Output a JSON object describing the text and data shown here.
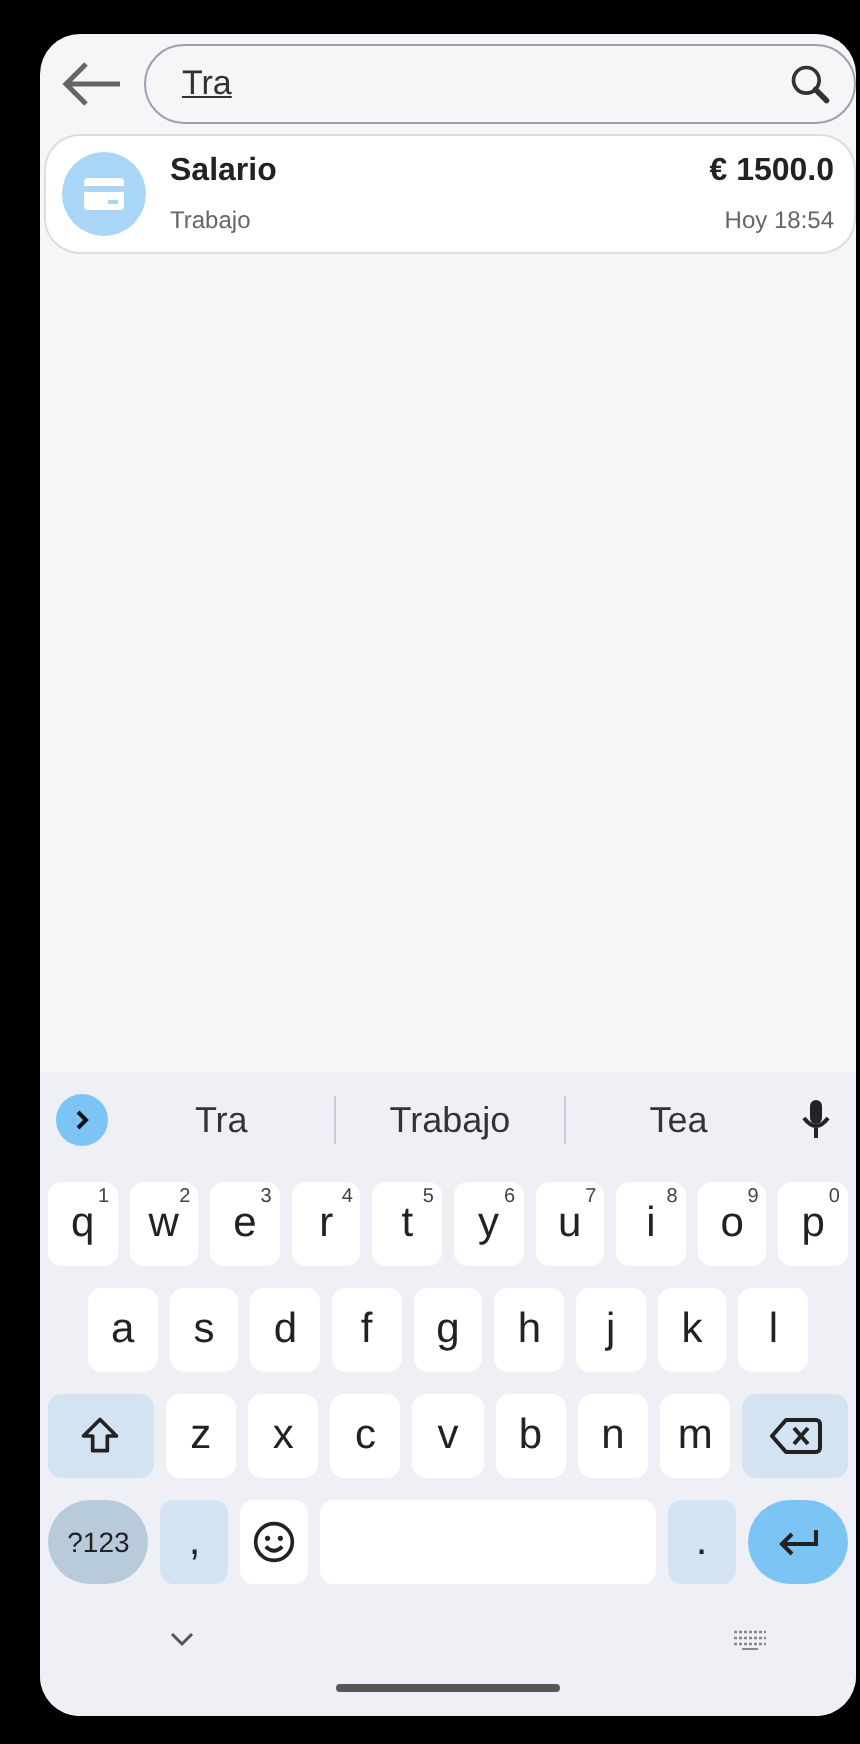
{
  "search": {
    "value": "Tra"
  },
  "results": [
    {
      "title": "Salario",
      "category": "Trabajo",
      "amount": "€ 1500.0",
      "time": "Hoy 18:54"
    }
  ],
  "keyboard": {
    "suggestions": [
      "Tra",
      "Trabajo",
      "Tea"
    ],
    "top_row": [
      {
        "kind": "letter",
        "label": "q",
        "hint": "1"
      },
      {
        "kind": "letter",
        "label": "w",
        "hint": "2"
      },
      {
        "kind": "letter",
        "label": "e",
        "hint": "3"
      },
      {
        "kind": "letter",
        "label": "r",
        "hint": "4"
      },
      {
        "kind": "letter",
        "label": "t",
        "hint": "5"
      },
      {
        "kind": "letter",
        "label": "y",
        "hint": "6"
      },
      {
        "kind": "letter",
        "label": "u",
        "hint": "7"
      },
      {
        "kind": "letter",
        "label": "i",
        "hint": "8"
      },
      {
        "kind": "letter",
        "label": "o",
        "hint": "9"
      },
      {
        "kind": "letter",
        "label": "p",
        "hint": "0"
      }
    ],
    "home_row": [
      {
        "kind": "letter",
        "label": "a"
      },
      {
        "kind": "letter",
        "label": "s"
      },
      {
        "kind": "letter",
        "label": "d"
      },
      {
        "kind": "letter",
        "label": "f"
      },
      {
        "kind": "letter",
        "label": "g"
      },
      {
        "kind": "letter",
        "label": "h"
      },
      {
        "kind": "letter",
        "label": "j"
      },
      {
        "kind": "letter",
        "label": "k"
      },
      {
        "kind": "letter",
        "label": "l"
      }
    ],
    "bottom_row": [
      {
        "kind": "shift"
      },
      {
        "kind": "letter",
        "label": "z"
      },
      {
        "kind": "letter",
        "label": "x"
      },
      {
        "kind": "letter",
        "label": "c"
      },
      {
        "kind": "letter",
        "label": "v"
      },
      {
        "kind": "letter",
        "label": "b"
      },
      {
        "kind": "letter",
        "label": "n"
      },
      {
        "kind": "letter",
        "label": "m"
      },
      {
        "kind": "backspace"
      }
    ],
    "function_row": [
      {
        "kind": "symbols",
        "label": "?123"
      },
      {
        "kind": "punct",
        "label": ","
      },
      {
        "kind": "emoji"
      },
      {
        "kind": "space"
      },
      {
        "kind": "punct",
        "label": "."
      },
      {
        "kind": "enter"
      }
    ]
  }
}
